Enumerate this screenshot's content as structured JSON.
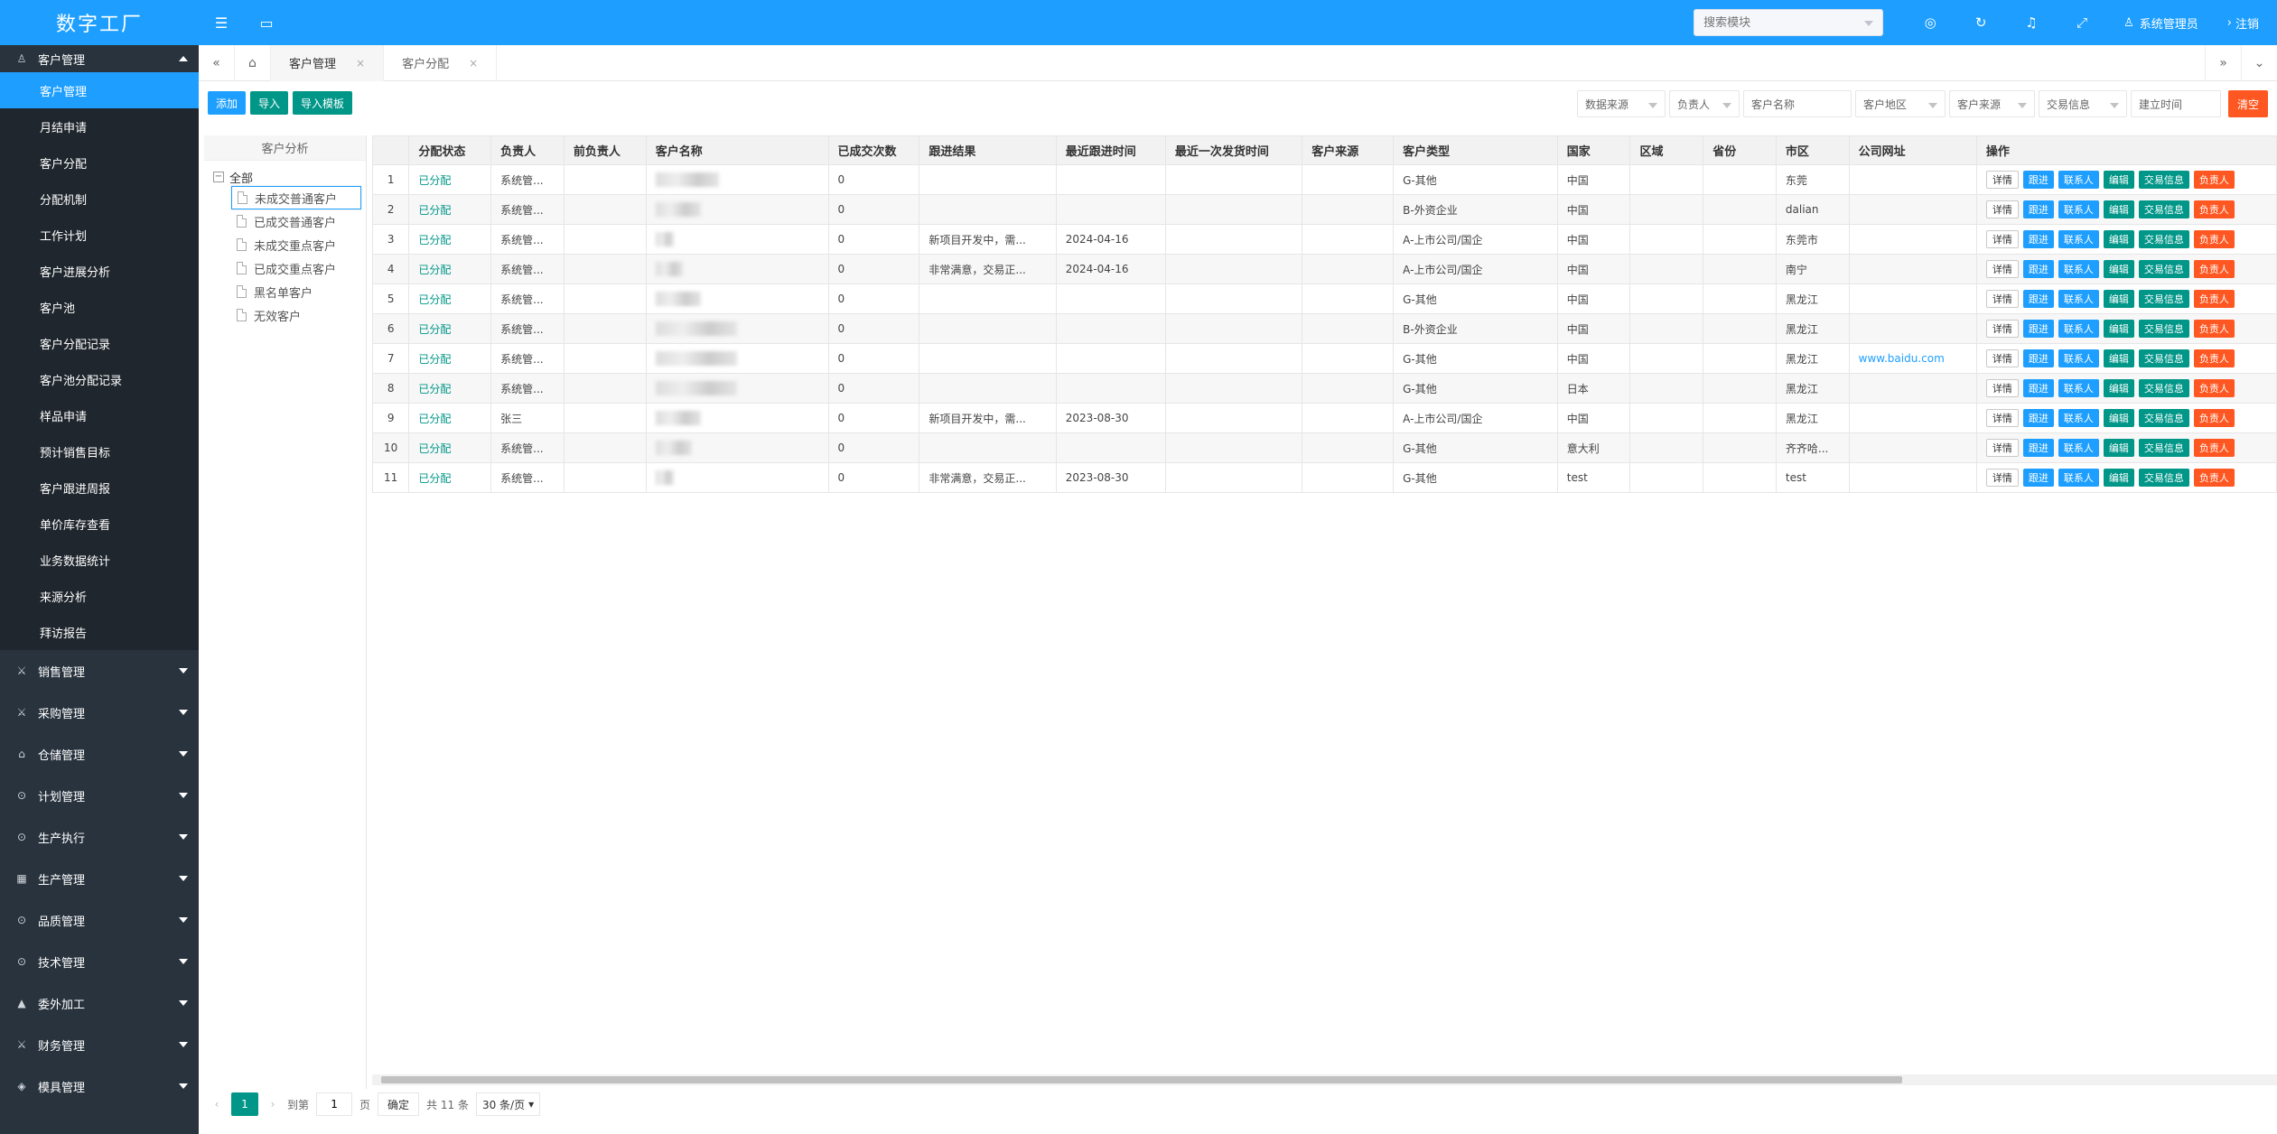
{
  "app": {
    "title": "数字工厂"
  },
  "header": {
    "search_placeholder": "搜索模块",
    "user": "系统管理员",
    "logout": "注销"
  },
  "sidebar": {
    "active_group": {
      "label": "客户管理"
    },
    "sub_items": [
      {
        "label": "客户管理"
      },
      {
        "label": "月结申请"
      },
      {
        "label": "客户分配"
      },
      {
        "label": "分配机制"
      },
      {
        "label": "工作计划"
      },
      {
        "label": "客户进展分析"
      },
      {
        "label": "客户池"
      },
      {
        "label": "客户分配记录"
      },
      {
        "label": "客户池分配记录"
      },
      {
        "label": "样品申请"
      },
      {
        "label": "预计销售目标"
      },
      {
        "label": "客户跟进周报"
      },
      {
        "label": "单价库存查看"
      },
      {
        "label": "业务数据统计"
      },
      {
        "label": "来源分析"
      },
      {
        "label": "拜访报告"
      }
    ],
    "groups": [
      {
        "label": "销售管理"
      },
      {
        "label": "采购管理"
      },
      {
        "label": "仓储管理"
      },
      {
        "label": "计划管理"
      },
      {
        "label": "生产执行"
      },
      {
        "label": "生产管理"
      },
      {
        "label": "品质管理"
      },
      {
        "label": "技术管理"
      },
      {
        "label": "委外加工"
      },
      {
        "label": "财务管理"
      },
      {
        "label": "模具管理"
      }
    ]
  },
  "tabs": [
    {
      "label": "客户管理"
    },
    {
      "label": "客户分配"
    }
  ],
  "toolbar": {
    "add": "添加",
    "import": "导入",
    "import_tpl": "导入模板"
  },
  "filters": {
    "data_source": "数据来源",
    "owner": "负责人",
    "customer_name": "客户名称",
    "region": "客户地区",
    "source": "客户来源",
    "trade_info": "交易信息",
    "created": "建立时间",
    "clear": "清空"
  },
  "tree": {
    "title": "客户分析",
    "root": "全部",
    "nodes": [
      "未成交普通客户",
      "已成交普通客户",
      "未成交重点客户",
      "已成交重点客户",
      "黑名单客户",
      "无效客户"
    ]
  },
  "table": {
    "headers": [
      "",
      "分配状态",
      "负责人",
      "前负责人",
      "客户名称",
      "已成交次数",
      "跟进结果",
      "最近跟进时间",
      "最近一次发货时间",
      "客户来源",
      "客户类型",
      "国家",
      "区域",
      "省份",
      "市区",
      "公司网址",
      "操作"
    ],
    "ops": [
      "详情",
      "跟进",
      "联系人",
      "编辑",
      "交易信息",
      "负责人"
    ],
    "rows": [
      {
        "no": "1",
        "status": "已分配",
        "owner": "系统管...",
        "deals": "0",
        "result": "",
        "last_follow": "",
        "type": "G-其他",
        "country": "中国",
        "city": "东莞",
        "site": ""
      },
      {
        "no": "2",
        "status": "已分配",
        "owner": "系统管...",
        "deals": "0",
        "result": "",
        "last_follow": "",
        "type": "B-外资企业",
        "country": "中国",
        "city": "dalian",
        "site": ""
      },
      {
        "no": "3",
        "status": "已分配",
        "owner": "系统管...",
        "deals": "0",
        "result": "新项目开发中，需...",
        "last_follow": "2024-04-16",
        "type": "A-上市公司/国企",
        "country": "中国",
        "city": "东莞市",
        "site": ""
      },
      {
        "no": "4",
        "status": "已分配",
        "owner": "系统管...",
        "deals": "0",
        "result": "非常满意，交易正...",
        "last_follow": "2024-04-16",
        "type": "A-上市公司/国企",
        "country": "中国",
        "city": "南宁",
        "site": ""
      },
      {
        "no": "5",
        "status": "已分配",
        "owner": "系统管...",
        "deals": "0",
        "result": "",
        "last_follow": "",
        "type": "G-其他",
        "country": "中国",
        "city": "黑龙江",
        "site": ""
      },
      {
        "no": "6",
        "status": "已分配",
        "owner": "系统管...",
        "deals": "0",
        "result": "",
        "last_follow": "",
        "type": "B-外资企业",
        "country": "中国",
        "city": "黑龙江",
        "site": ""
      },
      {
        "no": "7",
        "status": "已分配",
        "owner": "系统管...",
        "deals": "0",
        "result": "",
        "last_follow": "",
        "type": "G-其他",
        "country": "中国",
        "city": "黑龙江",
        "site": "www.baidu.com"
      },
      {
        "no": "8",
        "status": "已分配",
        "owner": "系统管...",
        "deals": "0",
        "result": "",
        "last_follow": "",
        "type": "G-其他",
        "country": "日本",
        "city": "黑龙江",
        "site": ""
      },
      {
        "no": "9",
        "status": "已分配",
        "owner": "张三",
        "deals": "0",
        "result": "新项目开发中，需...",
        "last_follow": "2023-08-30",
        "type": "A-上市公司/国企",
        "country": "中国",
        "city": "黑龙江",
        "site": ""
      },
      {
        "no": "10",
        "status": "已分配",
        "owner": "系统管...",
        "deals": "0",
        "result": "",
        "last_follow": "",
        "type": "G-其他",
        "country": "意大利",
        "city": "齐齐哈...",
        "site": ""
      },
      {
        "no": "11",
        "status": "已分配",
        "owner": "系统管...",
        "deals": "0",
        "result": "非常满意，交易正...",
        "last_follow": "2023-08-30",
        "type": "G-其他",
        "country": "test",
        "city": "test",
        "site": ""
      }
    ]
  },
  "pager": {
    "current": "1",
    "goto_label": "到第",
    "page_input": "1",
    "page_unit": "页",
    "ok": "确定",
    "total": "共 11 条",
    "size": "30 条/页"
  },
  "colors": {
    "primary": "#1e9fff",
    "green": "#009688",
    "orange": "#ff5722",
    "sidebar": "#28333e"
  }
}
